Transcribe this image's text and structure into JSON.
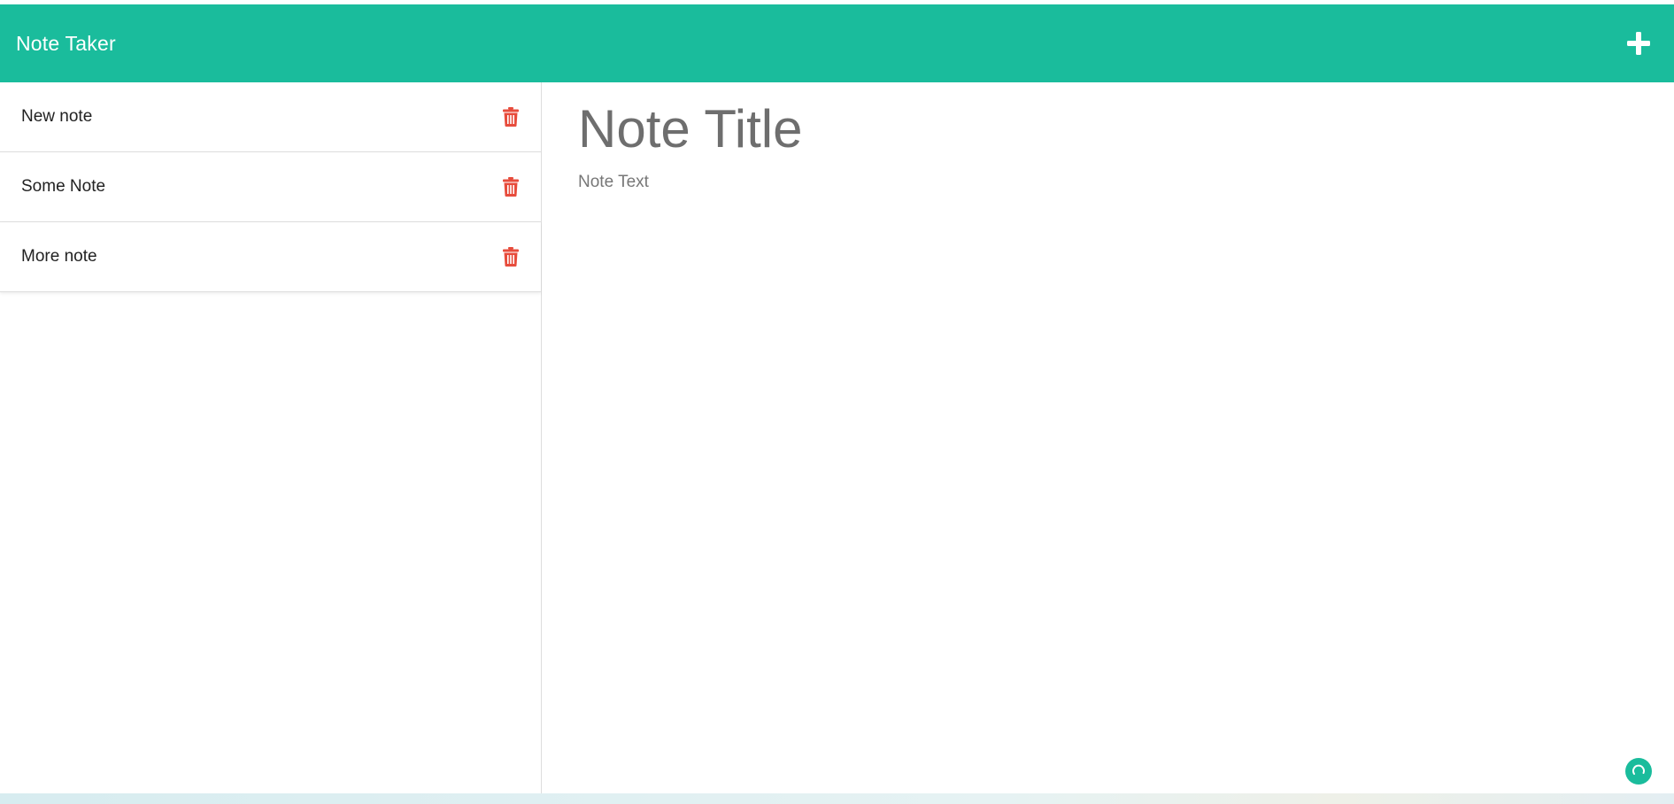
{
  "app": {
    "title": "Note Taker"
  },
  "header": {
    "add_icon": "plus-icon"
  },
  "sidebar": {
    "notes": [
      {
        "title": "New note",
        "delete_icon": "trash-icon"
      },
      {
        "title": "Some Note",
        "delete_icon": "trash-icon"
      },
      {
        "title": "More note",
        "delete_icon": "trash-icon"
      }
    ]
  },
  "editor": {
    "title_placeholder": "Note Title",
    "title_value": "",
    "text_placeholder": "Note Text",
    "text_value": ""
  },
  "widget": {
    "icon": "refresh-icon"
  },
  "colors": {
    "accent": "#1abc9c",
    "danger": "#e74c3c",
    "placeholder": "#6e6e6e"
  }
}
